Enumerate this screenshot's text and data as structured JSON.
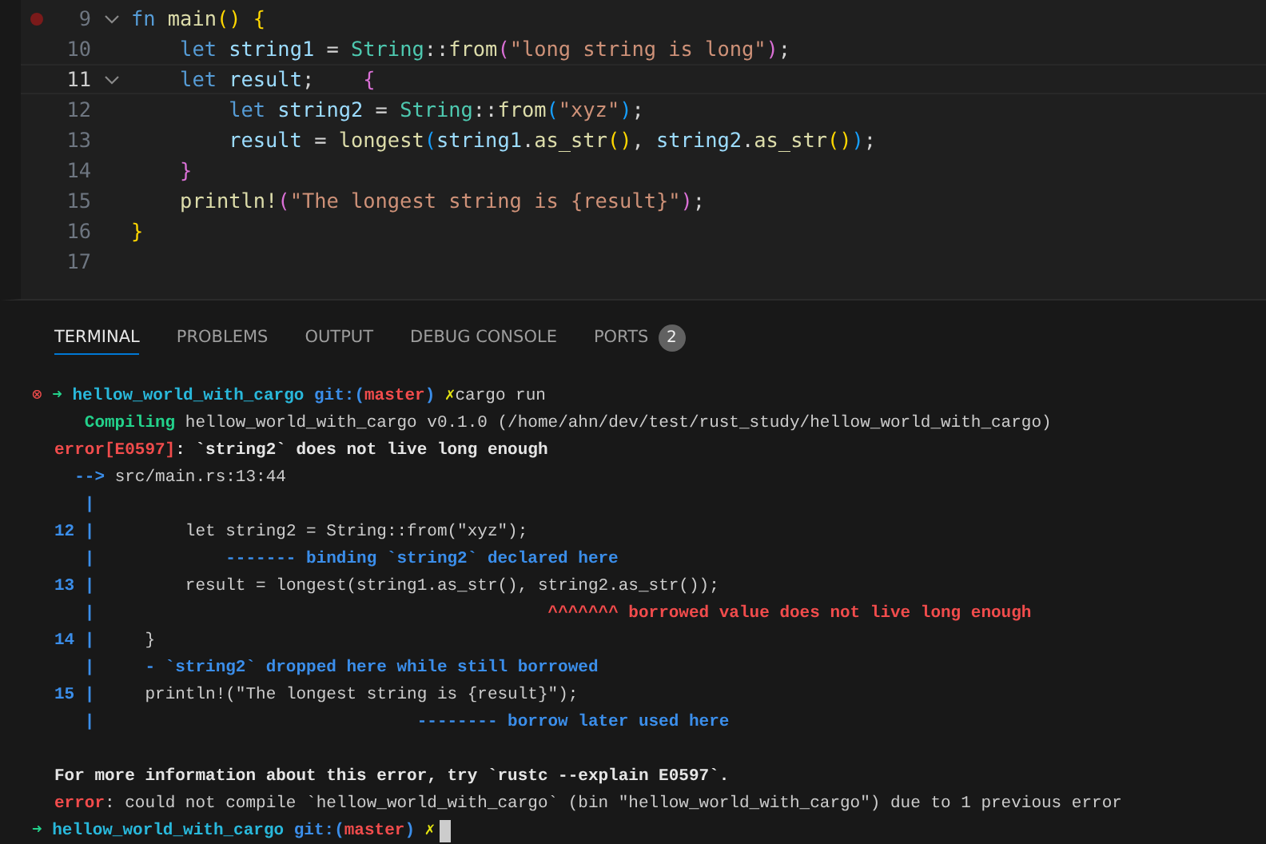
{
  "editor": {
    "lines": [
      {
        "number": "9",
        "breakpoint": true,
        "fold": true,
        "current": false,
        "tokens": [
          {
            "text": "fn",
            "kind": "keyword"
          },
          {
            "text": " main",
            "kind": "function"
          },
          {
            "text": "()",
            "kind": "bracket1"
          },
          {
            "text": " {",
            "kind": "bracket1"
          }
        ]
      },
      {
        "number": "10",
        "breakpoint": false,
        "fold": false,
        "current": false,
        "tokens": [
          {
            "text": "    let",
            "kind": "keyword"
          },
          {
            "text": " string1",
            "kind": "variable"
          },
          {
            "text": " = ",
            "kind": "plain"
          },
          {
            "text": "String",
            "kind": "type"
          },
          {
            "text": "::",
            "kind": "plain"
          },
          {
            "text": "from",
            "kind": "function"
          },
          {
            "text": "(",
            "kind": "bracket2"
          },
          {
            "text": "\"long string is long\"",
            "kind": "string"
          },
          {
            "text": ")",
            "kind": "bracket2"
          },
          {
            "text": ";",
            "kind": "plain"
          }
        ]
      },
      {
        "number": "11",
        "breakpoint": false,
        "fold": true,
        "current": true,
        "tokens": [
          {
            "text": "    let",
            "kind": "keyword"
          },
          {
            "text": " result",
            "kind": "variable"
          },
          {
            "text": ";    ",
            "kind": "plain"
          },
          {
            "text": "{",
            "kind": "bracket2"
          }
        ]
      },
      {
        "number": "12",
        "breakpoint": false,
        "fold": false,
        "current": false,
        "tokens": [
          {
            "text": "        let",
            "kind": "keyword"
          },
          {
            "text": " string2",
            "kind": "variable"
          },
          {
            "text": " = ",
            "kind": "plain"
          },
          {
            "text": "String",
            "kind": "type"
          },
          {
            "text": "::",
            "kind": "plain"
          },
          {
            "text": "from",
            "kind": "function"
          },
          {
            "text": "(",
            "kind": "bracket3"
          },
          {
            "text": "\"xyz\"",
            "kind": "string"
          },
          {
            "text": ")",
            "kind": "bracket3"
          },
          {
            "text": ";",
            "kind": "plain"
          }
        ]
      },
      {
        "number": "13",
        "breakpoint": false,
        "fold": false,
        "current": false,
        "tokens": [
          {
            "text": "        result",
            "kind": "variable"
          },
          {
            "text": " = ",
            "kind": "plain"
          },
          {
            "text": "longest",
            "kind": "function"
          },
          {
            "text": "(",
            "kind": "bracket3"
          },
          {
            "text": "string1",
            "kind": "variable"
          },
          {
            "text": ".",
            "kind": "plain"
          },
          {
            "text": "as_str",
            "kind": "function"
          },
          {
            "text": "()",
            "kind": "bracket1"
          },
          {
            "text": ", ",
            "kind": "plain"
          },
          {
            "text": "string2",
            "kind": "variable"
          },
          {
            "text": ".",
            "kind": "plain"
          },
          {
            "text": "as_str",
            "kind": "function"
          },
          {
            "text": "()",
            "kind": "bracket1"
          },
          {
            "text": ")",
            "kind": "bracket3"
          },
          {
            "text": ";",
            "kind": "plain"
          }
        ]
      },
      {
        "number": "14",
        "breakpoint": false,
        "fold": false,
        "current": false,
        "tokens": [
          {
            "text": "    }",
            "kind": "bracket2"
          }
        ]
      },
      {
        "number": "15",
        "breakpoint": false,
        "fold": false,
        "current": false,
        "tokens": [
          {
            "text": "    println!",
            "kind": "function"
          },
          {
            "text": "(",
            "kind": "bracket2"
          },
          {
            "text": "\"The longest string is {result}\"",
            "kind": "string"
          },
          {
            "text": ")",
            "kind": "bracket2"
          },
          {
            "text": ";",
            "kind": "plain"
          }
        ]
      },
      {
        "number": "16",
        "breakpoint": false,
        "fold": false,
        "current": false,
        "tokens": [
          {
            "text": "}",
            "kind": "bracket1"
          }
        ]
      },
      {
        "number": "17",
        "breakpoint": false,
        "fold": false,
        "current": false
      }
    ]
  },
  "panel": {
    "tabs": [
      {
        "label": "TERMINAL",
        "selected": true
      },
      {
        "label": "PROBLEMS",
        "selected": false
      },
      {
        "label": "OUTPUT",
        "selected": false
      },
      {
        "label": "DEBUG CONSOLE",
        "selected": false
      },
      {
        "label": "PORTS",
        "selected": false,
        "badge": "2"
      }
    ],
    "terminal": {
      "lines": [
        {
          "kind": "prompt",
          "segments": [
            {
              "text": "⊗ ",
              "kind": "failed"
            },
            {
              "text": "➜ ",
              "kind": "arrow"
            },
            {
              "text": "hellow_world_with_cargo",
              "kind": "dir"
            },
            {
              "text": " git:(",
              "kind": "git"
            },
            {
              "text": "master",
              "kind": "branch"
            },
            {
              "text": ")",
              "kind": "git"
            },
            {
              "text": " ✗",
              "kind": "dirty"
            },
            {
              "text": "cargo run",
              "kind": "plain"
            }
          ]
        },
        {
          "kind": "output",
          "segments": [
            {
              "text": "   Compiling",
              "kind": "compiling"
            },
            {
              "text": " hellow_world_with_cargo v0.1.0 (/home/ahn/dev/test/rust_study/hellow_world_with_cargo)",
              "kind": "plain"
            }
          ]
        },
        {
          "kind": "output",
          "segments": [
            {
              "text": "error[E0597]",
              "kind": "error"
            },
            {
              "text": ": `string2` does not live long enough",
              "kind": "bold"
            }
          ]
        },
        {
          "kind": "output",
          "segments": [
            {
              "text": "  -->",
              "kind": "note"
            },
            {
              "text": " src/main.rs:13:44",
              "kind": "plain"
            }
          ]
        },
        {
          "kind": "output",
          "segments": [
            {
              "text": "   |",
              "kind": "note"
            }
          ]
        },
        {
          "kind": "output",
          "segments": [
            {
              "text": "12 |",
              "kind": "note"
            },
            {
              "text": "         let string2 = String::from(\"xyz\");",
              "kind": "plain"
            }
          ]
        },
        {
          "kind": "output",
          "segments": [
            {
              "text": "   |             ------- binding `string2` declared here",
              "kind": "note"
            }
          ]
        },
        {
          "kind": "output",
          "segments": [
            {
              "text": "13 |",
              "kind": "note"
            },
            {
              "text": "         result = longest(string1.as_str(), string2.as_str());",
              "kind": "plain"
            }
          ]
        },
        {
          "kind": "output",
          "segments": [
            {
              "text": "   |",
              "kind": "note"
            },
            {
              "text": "                                             ^^^^^^^ borrowed value does not live long enough",
              "kind": "error"
            }
          ]
        },
        {
          "kind": "output",
          "segments": [
            {
              "text": "14 |",
              "kind": "note"
            },
            {
              "text": "     }",
              "kind": "plain"
            }
          ]
        },
        {
          "kind": "output",
          "segments": [
            {
              "text": "   |     - `string2` dropped here while still borrowed",
              "kind": "note"
            }
          ]
        },
        {
          "kind": "output",
          "segments": [
            {
              "text": "15 |",
              "kind": "note"
            },
            {
              "text": "     println!(\"The longest string is {result}\");",
              "kind": "plain"
            }
          ]
        },
        {
          "kind": "output",
          "segments": [
            {
              "text": "   |                                -------- borrow later used here",
              "kind": "note"
            }
          ]
        },
        {
          "kind": "blank"
        },
        {
          "kind": "output",
          "segments": [
            {
              "text": "For more information about this error, try `rustc --explain E0597`.",
              "kind": "bold"
            }
          ]
        },
        {
          "kind": "output",
          "segments": [
            {
              "text": "error",
              "kind": "error"
            },
            {
              "text": ": could not compile `hellow_world_with_cargo` (bin \"hellow_world_with_cargo\") due to 1 previous error",
              "kind": "plain"
            }
          ]
        },
        {
          "kind": "prompt",
          "cursor": true,
          "segments": [
            {
              "text": "➜ ",
              "kind": "arrow"
            },
            {
              "text": "hellow_world_with_cargo",
              "kind": "dir"
            },
            {
              "text": " git:(",
              "kind": "git"
            },
            {
              "text": "master",
              "kind": "branch"
            },
            {
              "text": ")",
              "kind": "git"
            },
            {
              "text": " ✗",
              "kind": "dirty"
            }
          ]
        }
      ]
    }
  }
}
